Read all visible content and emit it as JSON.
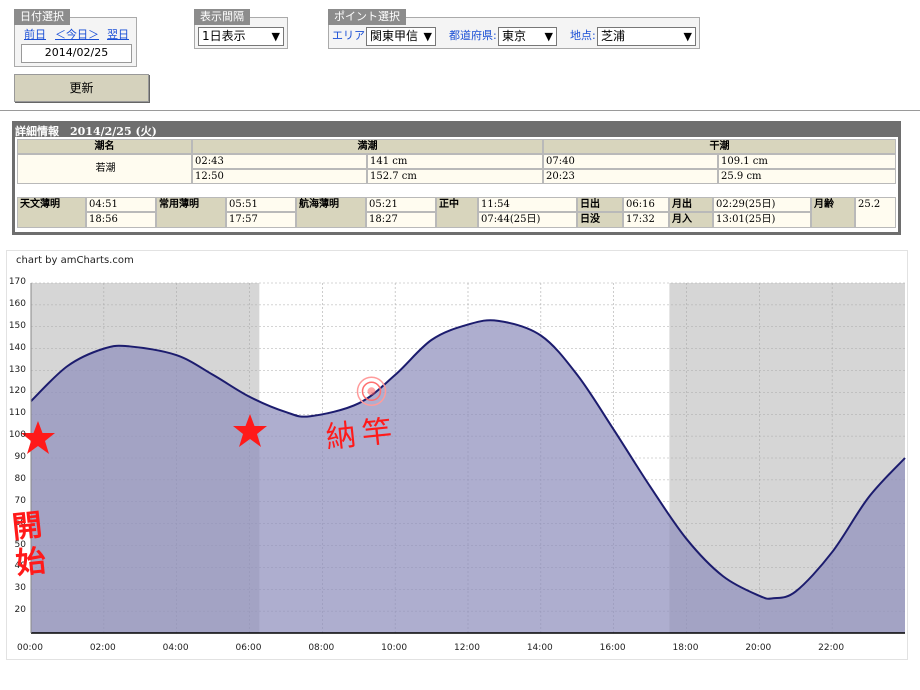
{
  "date_select": {
    "title": "日付選択",
    "prev": "前日",
    "today": "＜今日＞",
    "next": "翌日",
    "date": "2014/02/25"
  },
  "interval": {
    "title": "表示間隔",
    "value": "1日表示"
  },
  "point": {
    "title": "ポイント選択",
    "area_label": "エリア:",
    "area_value": "関東甲信",
    "pref_label": "都道府県:",
    "pref_value": "東京",
    "spot_label": "地点:",
    "spot_value": "芝浦"
  },
  "update_button": "更新",
  "detail": {
    "title": "詳細情報　2014/2/25 (火)",
    "tide_name_header": "潮名",
    "high_header": "満潮",
    "low_header": "干潮",
    "tide_name": "若潮",
    "high": [
      {
        "time": "02:43",
        "height": "141 cm"
      },
      {
        "time": "12:50",
        "height": "152.7 cm"
      }
    ],
    "low": [
      {
        "time": "07:40",
        "height": "109.1 cm"
      },
      {
        "time": "20:23",
        "height": "25.9 cm"
      }
    ],
    "astro": [
      {
        "label": "天文薄明",
        "v1": "04:51",
        "v2": "18:56"
      },
      {
        "label": "常用薄明",
        "v1": "05:51",
        "v2": "17:57"
      },
      {
        "label": "航海薄明",
        "v1": "05:21",
        "v2": "18:27"
      },
      {
        "label": "正中",
        "v1": "11:54",
        "v2": "07:44(25日)"
      }
    ],
    "sun_rise_label": "日出",
    "sun_rise": "06:16",
    "sun_set_label": "日没",
    "sun_set": "17:32",
    "moon_rise_label": "月出",
    "moon_rise": "02:29(25日)",
    "moon_set_label": "月入",
    "moon_set": "13:01(25日)",
    "moon_age_label": "月齢",
    "moon_age": "25.2"
  },
  "chart_credit": "chart by amCharts.com",
  "annotations": {
    "start": "開始",
    "nakan": "納竿"
  },
  "colors": {
    "night_band": "#d6d6d6",
    "tide_fill": "#8f8fbd",
    "tide_line": "#1c1c6e",
    "annotation_red": "#ff1a1a"
  },
  "chart_data": {
    "type": "area",
    "xlabel": "",
    "ylabel": "",
    "xlim": [
      0,
      24
    ],
    "ylim": [
      10,
      170
    ],
    "yticks": [
      20,
      30,
      40,
      50,
      60,
      70,
      80,
      90,
      100,
      110,
      120,
      130,
      140,
      150,
      160,
      170
    ],
    "xticks": [
      "00:00",
      "02:00",
      "04:00",
      "06:00",
      "08:00",
      "10:00",
      "12:00",
      "14:00",
      "16:00",
      "18:00",
      "20:00",
      "22:00"
    ],
    "grid": true,
    "x": [
      0,
      1,
      2,
      2.72,
      4,
      5,
      6,
      7,
      7.67,
      9,
      10,
      11,
      12,
      12.83,
      14,
      15,
      16,
      17,
      18,
      19,
      20,
      20.38,
      21,
      22,
      23,
      24
    ],
    "y": [
      116,
      132,
      140,
      141,
      137,
      128,
      118,
      111,
      109.1,
      115,
      128,
      144,
      151,
      152.7,
      146,
      128,
      103,
      77,
      53,
      36,
      27,
      25.9,
      29,
      47,
      72,
      90
    ],
    "night_bands": [
      [
        0,
        6.27
      ],
      [
        17.53,
        24
      ]
    ]
  }
}
